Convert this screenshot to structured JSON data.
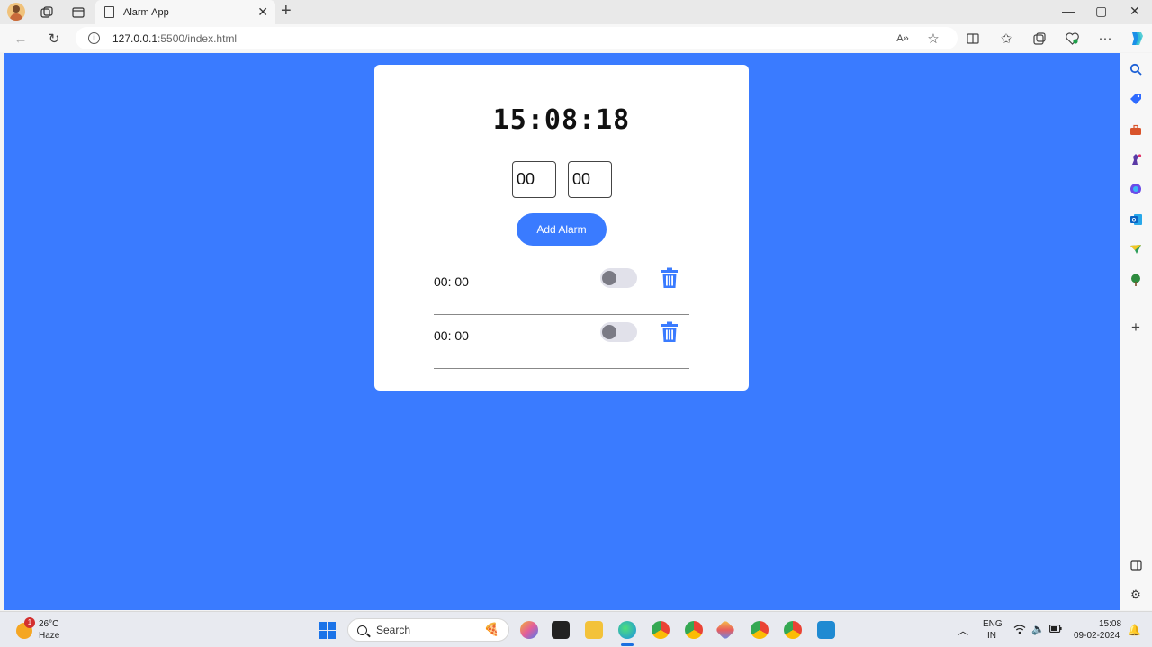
{
  "browser": {
    "tab_title": "Alarm App",
    "url_host": "127.0.0.1",
    "url_rest": ":5500/index.html"
  },
  "app": {
    "clock": "15:08:18",
    "hour_value": "00",
    "minute_value": "00",
    "add_button_label": "Add Alarm",
    "alarms": [
      {
        "time": "00: 00"
      },
      {
        "time": "00: 00"
      }
    ]
  },
  "taskbar": {
    "weather_badge": "1",
    "weather_temp": "26°C",
    "weather_desc": "Haze",
    "search_label": "Search",
    "lang_top": "ENG",
    "lang_bottom": "IN",
    "clock_time": "15:08",
    "clock_date": "09-02-2024"
  },
  "colors": {
    "page_background": "#3a7bff",
    "accent": "#3a7bff"
  }
}
